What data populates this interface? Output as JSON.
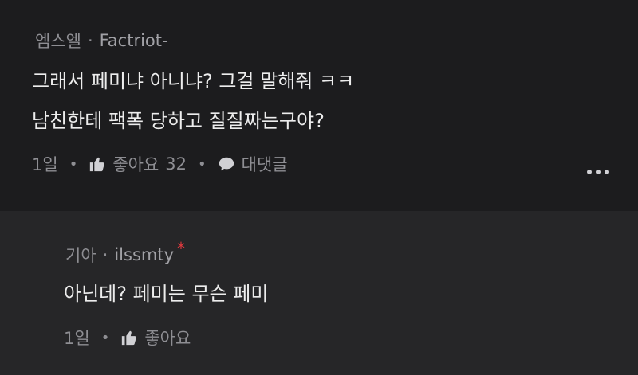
{
  "comments": [
    {
      "level": "엠스엘",
      "sep": "·",
      "nickname": "Factriot-",
      "lines": [
        "그래서 페미냐 아니냐? 그걸 말해줘 ㅋㅋ",
        "남친한테 팩폭 당하고 질질짜는구야?"
      ],
      "time": "1일",
      "like_label": "좋아요",
      "like_count": "32",
      "reply_label": "대댓글"
    },
    {
      "level": "기아",
      "sep": "·",
      "nickname": "ilssmty",
      "badge": "*",
      "lines": [
        "아닌데? 페미는 무슨 페미"
      ],
      "time": "1일",
      "like_label": "좋아요"
    }
  ],
  "colors": {
    "background": "#1c1c1e",
    "reply_background": "#262628",
    "badge": "#e0393e"
  },
  "icons": [
    "thumbs-up-icon",
    "speech-bubble-icon",
    "more-icon"
  ]
}
